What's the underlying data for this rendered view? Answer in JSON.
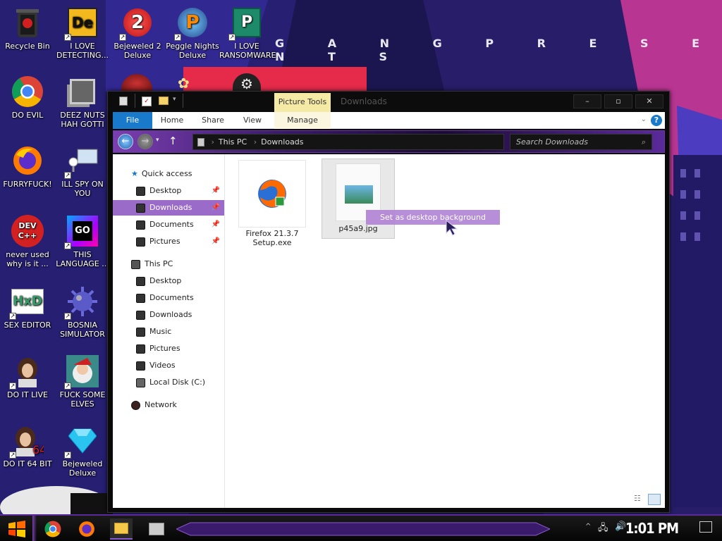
{
  "desktop": {
    "banner_text": "G A N G   P R E S E N T S",
    "icons": [
      {
        "label": "Recycle Bin"
      },
      {
        "label": "I LOVE DETECTING..."
      },
      {
        "label": "Bejeweled 2 Deluxe"
      },
      {
        "label": "Peggle Nights Deluxe"
      },
      {
        "label": "I LOVE RANSOMWARE"
      },
      {
        "label": "DO EVIL"
      },
      {
        "label": "DEEZ NUTS HAH GOTTI"
      },
      {
        "label": "FURRYFUCK!"
      },
      {
        "label": "ILL SPY ON YOU"
      },
      {
        "label": "never used why is it ..."
      },
      {
        "label": "THIS LANGUAGE ..."
      },
      {
        "label": "SEX EDITOR"
      },
      {
        "label": "BOSNIA SIMULATOR"
      },
      {
        "label": "DO IT LIVE"
      },
      {
        "label": "FUCK SOME ELVES"
      },
      {
        "label": "DO IT 64 BIT"
      },
      {
        "label": "Bejeweled Deluxe"
      }
    ],
    "icon_glyphs": {
      "devcpp": "DEV C++",
      "go": "GO",
      "hxd": "HxD",
      "badge64": "64",
      "dice": "De",
      "peggle_letter": "P",
      "bej2_num": "2"
    }
  },
  "window": {
    "title": "Downloads",
    "picture_tools": "Picture Tools",
    "controls": {
      "minimize": "–",
      "maximize": "▫",
      "close": "✕"
    },
    "ribbon": {
      "file": "File",
      "home": "Home",
      "share": "Share",
      "view": "View",
      "manage": "Manage"
    },
    "address": {
      "root": "This PC",
      "current": "Downloads",
      "sep": "›"
    },
    "search_placeholder": "Search Downloads",
    "nav": {
      "quick_access": "Quick access",
      "qa_items": [
        "Desktop",
        "Downloads",
        "Documents",
        "Pictures"
      ],
      "this_pc": "This PC",
      "pc_items": [
        "Desktop",
        "Documents",
        "Downloads",
        "Music",
        "Pictures",
        "Videos",
        "Local Disk (C:)"
      ],
      "network": "Network"
    },
    "files": [
      {
        "name": "Firefox 21.3.7 Setup.exe"
      },
      {
        "name": "p45a9.jpg"
      }
    ],
    "context_hint": "Set as desktop background"
  },
  "taskbar": {
    "clock": "1:01 PM"
  }
}
